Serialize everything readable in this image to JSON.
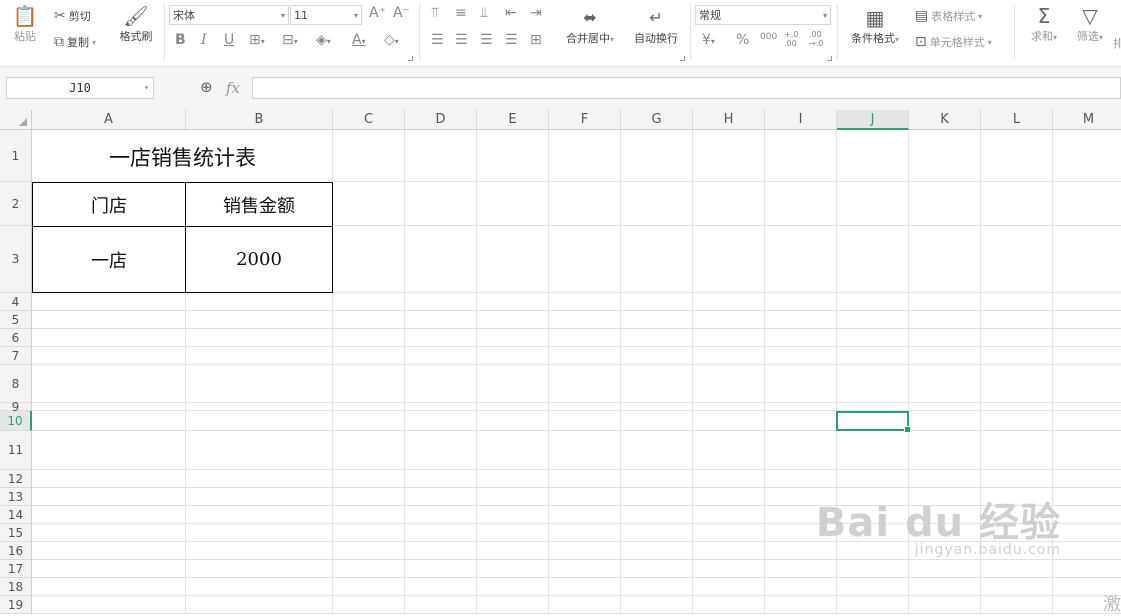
{
  "ribbon": {
    "clipboard": {
      "paste": "粘贴",
      "cut": "剪切",
      "copy": "复制",
      "format_painter": "格式刷"
    },
    "font": {
      "name": "宋体",
      "size": "11",
      "grow": "A⁺",
      "shrink": "A⁻",
      "bold": "B",
      "italic": "I",
      "underline": "U"
    },
    "alignment": {
      "merge_center": "合并居中",
      "wrap_text": "自动换行"
    },
    "number": {
      "format": "常规",
      "currency": "¥",
      "percent": "%",
      "thousands": "000",
      "inc_decimal": "+.0 .00",
      "dec_decimal": ".00 →.0"
    },
    "styles": {
      "conditional_format": "条件格式",
      "table_style": "表格样式",
      "cell_style": "单元格样式"
    },
    "editing": {
      "sum": "求和",
      "filter": "筛选",
      "overflow": "排"
    }
  },
  "formula_bar": {
    "name_box": "J10",
    "fx_label": "fx",
    "content": ""
  },
  "sheet": {
    "columns": [
      "A",
      "B",
      "C",
      "D",
      "E",
      "F",
      "G",
      "H",
      "I",
      "J",
      "K",
      "L",
      "M"
    ],
    "selected_column": "J",
    "rows": [
      "1",
      "2",
      "3",
      "4",
      "5",
      "6",
      "7",
      "8",
      "9",
      "10",
      "11",
      "12",
      "13",
      "14",
      "15",
      "16",
      "17",
      "18",
      "19"
    ],
    "selected_row": "10",
    "cells": {
      "title": "一店销售统计表",
      "header_store": "门店",
      "header_amount": "销售金额",
      "store_value": "一店",
      "amount_value": "2000"
    }
  },
  "watermark": {
    "logo": "Bai du 经验",
    "url": "jingyan.baidu.com"
  },
  "corner_text": "激"
}
